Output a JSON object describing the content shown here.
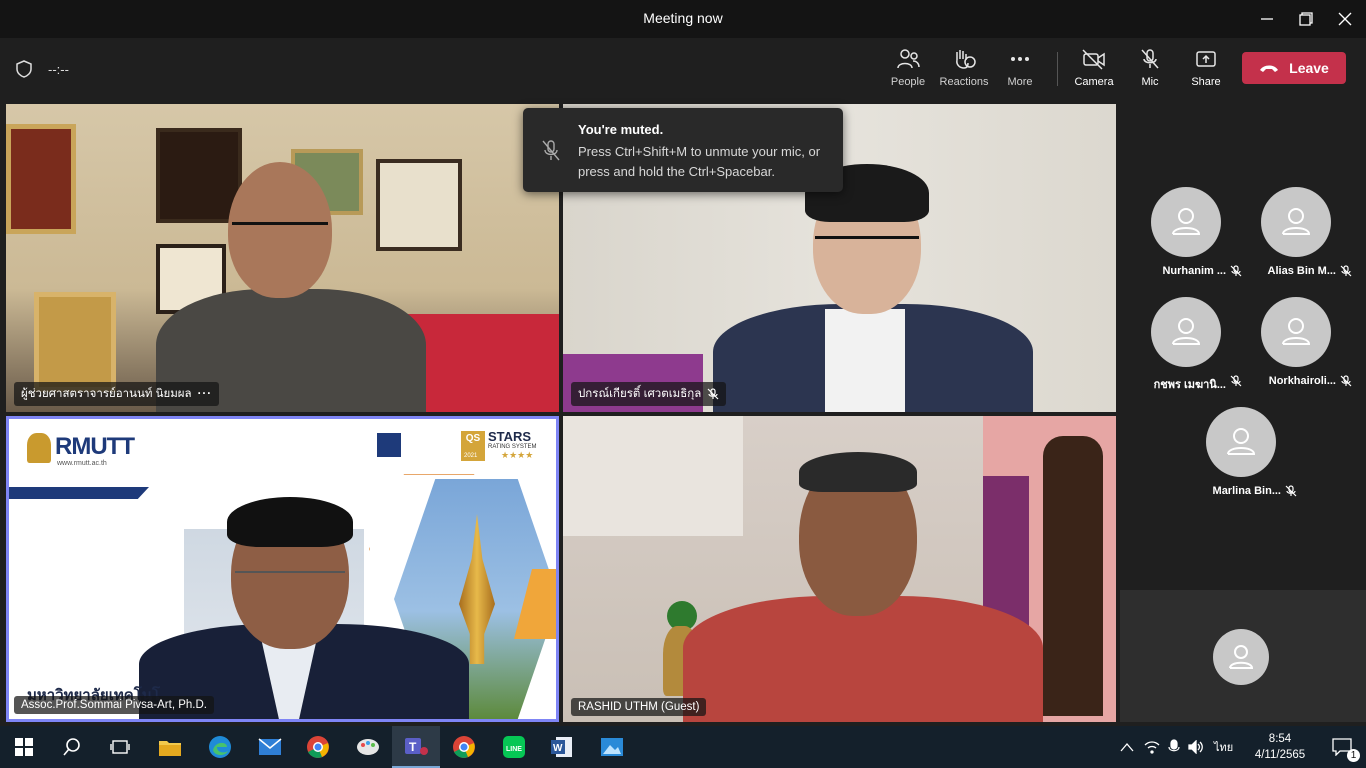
{
  "window": {
    "title": "Meeting now"
  },
  "toolbar": {
    "timer": "--:--",
    "people": "People",
    "reactions": "Reactions",
    "more": "More",
    "camera": "Camera",
    "mic": "Mic",
    "share": "Share",
    "leave": "Leave"
  },
  "toast": {
    "title": "You're muted.",
    "body": "Press Ctrl+Shift+M to unmute your mic, or press and hold the Ctrl+Spacebar."
  },
  "tiles": [
    {
      "name": "ผู้ช่วยศาสตราจารย์อานนท์ นิยมผล",
      "more": "···"
    },
    {
      "name": "ปกรณ์เกียรติ์ เศวตเมธิกุล"
    },
    {
      "name": "Assoc.Prof.Sommai Pivsa-Art, Ph.D."
    },
    {
      "name": "RASHID UTHM (Guest)"
    }
  ],
  "slide": {
    "logo": "RMUTT",
    "url": "www.rmutt.ac.th",
    "thai_title": "มหาวิทยาลัยเทคโนโ",
    "qs": "QS",
    "stars": "STARS",
    "rating": "RATING SYSTEM",
    "year": "2021",
    "star_rating": "★★★★"
  },
  "roster": [
    {
      "name": "Nurhanim ..."
    },
    {
      "name": "Alias Bin M..."
    },
    {
      "name": "กชพร เมฆานิ..."
    },
    {
      "name": "Norkhairoli..."
    },
    {
      "name": "Marlina Bin..."
    }
  ],
  "taskbar": {
    "lang": "ไทย",
    "time": "8:54",
    "date": "4/11/2565",
    "notifications": "1"
  },
  "colors": {
    "leave": "#c4314b",
    "accent": "#6264a7"
  }
}
